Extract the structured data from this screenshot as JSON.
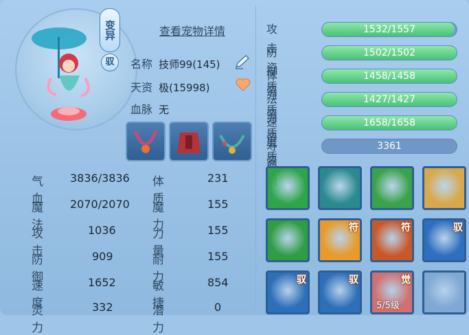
{
  "header": {
    "mutation_badge": "变异",
    "control_badge": "驭",
    "view_details_link": "查看宠物详情"
  },
  "profile": {
    "name_label": "名称",
    "name_value": "技师99(145)",
    "talent_label": "天资",
    "talent_value": "极(15998)",
    "bloodline_label": "血脉",
    "bloodline_value": "无"
  },
  "stats": [
    {
      "label": "气血",
      "value": "3836/3836"
    },
    {
      "label": "魔法",
      "value": "2070/2070"
    },
    {
      "label": "攻击",
      "value": "1036"
    },
    {
      "label": "防御",
      "value": "909"
    },
    {
      "label": "速度",
      "value": "1652"
    },
    {
      "label": "灵力",
      "value": "332"
    }
  ],
  "attributes": [
    {
      "label": "体质",
      "value": "231"
    },
    {
      "label": "魔力",
      "value": "155"
    },
    {
      "label": "力量",
      "value": "155"
    },
    {
      "label": "耐力",
      "value": "155"
    },
    {
      "label": "敏捷",
      "value": "854"
    },
    {
      "label": "潜力",
      "value": "0"
    }
  ],
  "aptitudes": [
    {
      "label": "攻击资质",
      "value": "1532/1557",
      "fraction": 0.984
    },
    {
      "label": "防御资质",
      "value": "1502/1502",
      "fraction": 1.0
    },
    {
      "label": "体力资质",
      "value": "1458/1458",
      "fraction": 1.0
    },
    {
      "label": "法力资质",
      "value": "1427/1427",
      "fraction": 1.0
    },
    {
      "label": "速度资质",
      "value": "1658/1658",
      "fraction": 1.0
    }
  ],
  "lifespan": {
    "label": "寿　命",
    "value": "3361"
  },
  "skills": [
    {
      "tag": "",
      "level": "",
      "color": "#2fa54a"
    },
    {
      "tag": "",
      "level": "",
      "color": "#2b8a8f"
    },
    {
      "tag": "",
      "level": "",
      "color": "#3aa24a"
    },
    {
      "tag": "",
      "level": "",
      "color": "#d9a84a"
    },
    {
      "tag": "",
      "level": "",
      "color": "#2f9d42"
    },
    {
      "tag": "符",
      "level": "",
      "color": "#e89a2a"
    },
    {
      "tag": "符",
      "level": "",
      "color": "#c8582a"
    },
    {
      "tag": "驭",
      "level": "",
      "color": "#2f6fbf"
    },
    {
      "tag": "驭",
      "level": "",
      "color": "#2e6fb9"
    },
    {
      "tag": "驭",
      "level": "",
      "color": "#2e6fb9"
    },
    {
      "tag": "觉",
      "level": "5/5级",
      "color": "#d07070"
    },
    {
      "tag": "",
      "level": "",
      "color": "#7fa8d3"
    }
  ]
}
